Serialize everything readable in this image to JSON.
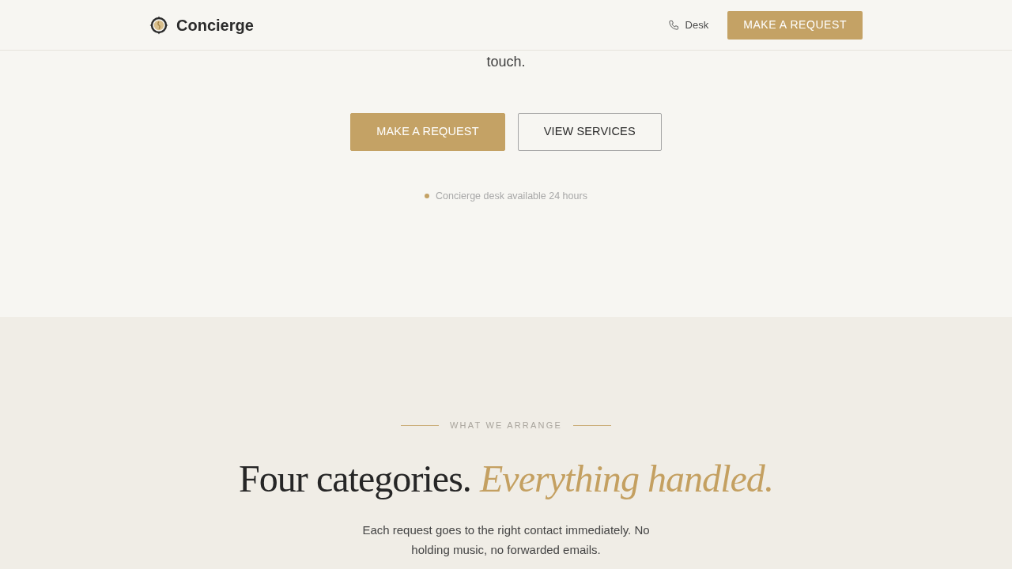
{
  "header": {
    "brand": "Concierge",
    "desk_link": "Desk",
    "cta": "MAKE A REQUEST"
  },
  "hero": {
    "text": "touch.",
    "buttons": [
      {
        "label": "MAKE A REQUEST",
        "kind": "primary"
      },
      {
        "label": "VIEW SERVICES",
        "kind": "outline"
      }
    ],
    "status": "Concierge desk available 24 hours"
  },
  "section": {
    "eyebrow": "WHAT WE ARRANGE",
    "heading": "Four categories. *Everything handled.*",
    "description": "Each request goes to the right contact immediately. No holding music, no forwarded emails."
  }
}
